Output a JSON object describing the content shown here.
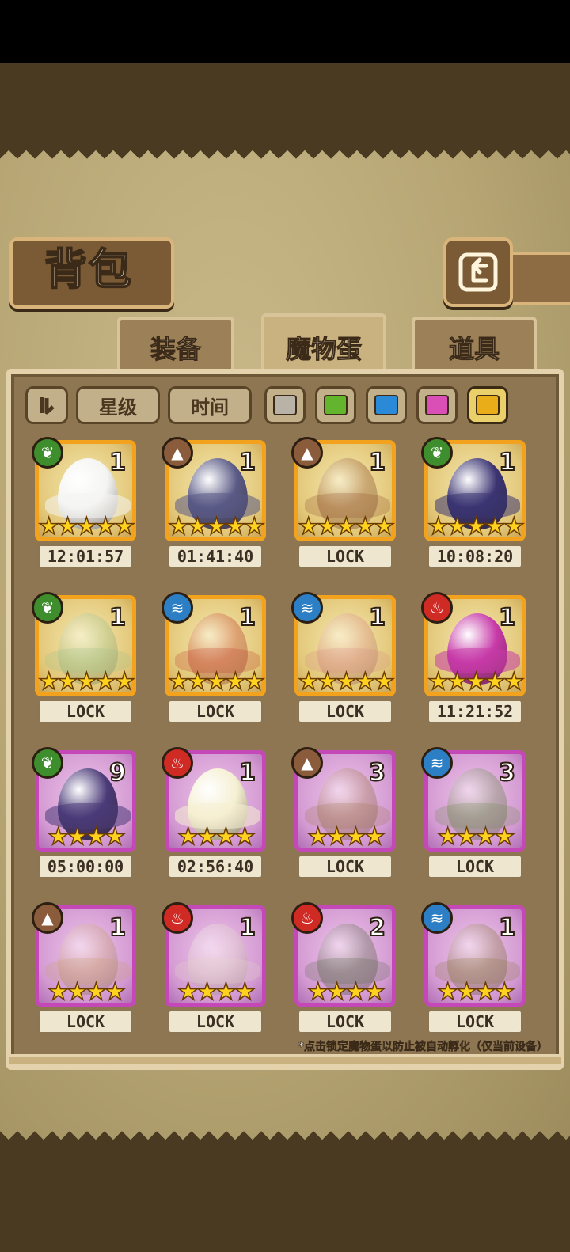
{
  "title": "背包",
  "back_icon": "return-icon",
  "tabs": [
    {
      "label": "装备",
      "active": false
    },
    {
      "label": "魔物蛋",
      "active": true
    },
    {
      "label": "道具",
      "active": false
    }
  ],
  "filters": {
    "sort_icon": "sort-toggle-icon",
    "star_label": "星级",
    "time_label": "时间",
    "rarity_colors": [
      {
        "name": "gray",
        "color": "#b8b3a6",
        "selected": false
      },
      {
        "name": "green",
        "color": "#63b52e",
        "selected": false
      },
      {
        "name": "blue",
        "color": "#2a8ad8",
        "selected": false
      },
      {
        "name": "pink",
        "color": "#d94fb6",
        "selected": false
      },
      {
        "name": "gold",
        "color": "#e8ad18",
        "selected": true
      }
    ]
  },
  "eggs": [
    {
      "element": "grass",
      "count": "1",
      "stars": "★★★★★",
      "rarity": "gold",
      "status": "12:01:57",
      "locked": false,
      "egg_color": "#f4f4f2"
    },
    {
      "element": "earth",
      "count": "1",
      "stars": "★★★★★",
      "rarity": "gold",
      "status": "01:41:40",
      "locked": false,
      "egg_color": "#5a5a86"
    },
    {
      "element": "earth",
      "count": "1",
      "stars": "★★★★★",
      "rarity": "gold",
      "status": "LOCK",
      "locked": true,
      "egg_color": "#8a4a2a"
    },
    {
      "element": "grass",
      "count": "1",
      "stars": "★★★★★",
      "rarity": "gold",
      "status": "10:08:20",
      "locked": false,
      "egg_color": "#3b3472"
    },
    {
      "element": "grass",
      "count": "1",
      "stars": "★★★★★",
      "rarity": "gold",
      "status": "LOCK",
      "locked": true,
      "egg_color": "#9bbf8a"
    },
    {
      "element": "water",
      "count": "1",
      "stars": "★★★★★",
      "rarity": "gold",
      "status": "LOCK",
      "locked": true,
      "egg_color": "#c0392b"
    },
    {
      "element": "water",
      "count": "1",
      "stars": "★★★★★",
      "rarity": "gold",
      "status": "LOCK",
      "locked": true,
      "egg_color": "#d88a88"
    },
    {
      "element": "fire",
      "count": "1",
      "stars": "★★★★★",
      "rarity": "gold",
      "status": "11:21:52",
      "locked": false,
      "egg_color": "#c73aa8"
    },
    {
      "element": "grass",
      "count": "9",
      "stars": "★★★★",
      "rarity": "purple",
      "status": "05:00:00",
      "locked": false,
      "egg_color": "#4a3a78"
    },
    {
      "element": "fire",
      "count": "1",
      "stars": "★★★★",
      "rarity": "purple",
      "status": "02:56:40",
      "locked": false,
      "egg_color": "#f5efd2"
    },
    {
      "element": "earth",
      "count": "3",
      "stars": "★★★★",
      "rarity": "purple",
      "status": "LOCK",
      "locked": true,
      "egg_color": "#a0784a"
    },
    {
      "element": "water",
      "count": "3",
      "stars": "★★★★",
      "rarity": "purple",
      "status": "LOCK",
      "locked": true,
      "egg_color": "#6a8a4a"
    },
    {
      "element": "earth",
      "count": "1",
      "stars": "★★★★",
      "rarity": "purple",
      "status": "LOCK",
      "locked": true,
      "egg_color": "#c8a070"
    },
    {
      "element": "fire",
      "count": "1",
      "stars": "★★★★",
      "rarity": "purple",
      "status": "LOCK",
      "locked": true,
      "egg_color": "#e2d6c8"
    },
    {
      "element": "fire",
      "count": "2",
      "stars": "★★★★",
      "rarity": "purple",
      "status": "LOCK",
      "locked": true,
      "egg_color": "#5a6a4a"
    },
    {
      "element": "water",
      "count": "1",
      "stars": "★★★★",
      "rarity": "purple",
      "status": "LOCK",
      "locked": true,
      "egg_color": "#8a7a40"
    }
  ],
  "note": "*点击锁定魔物蛋以防止被自动孵化（仅当前设备）"
}
